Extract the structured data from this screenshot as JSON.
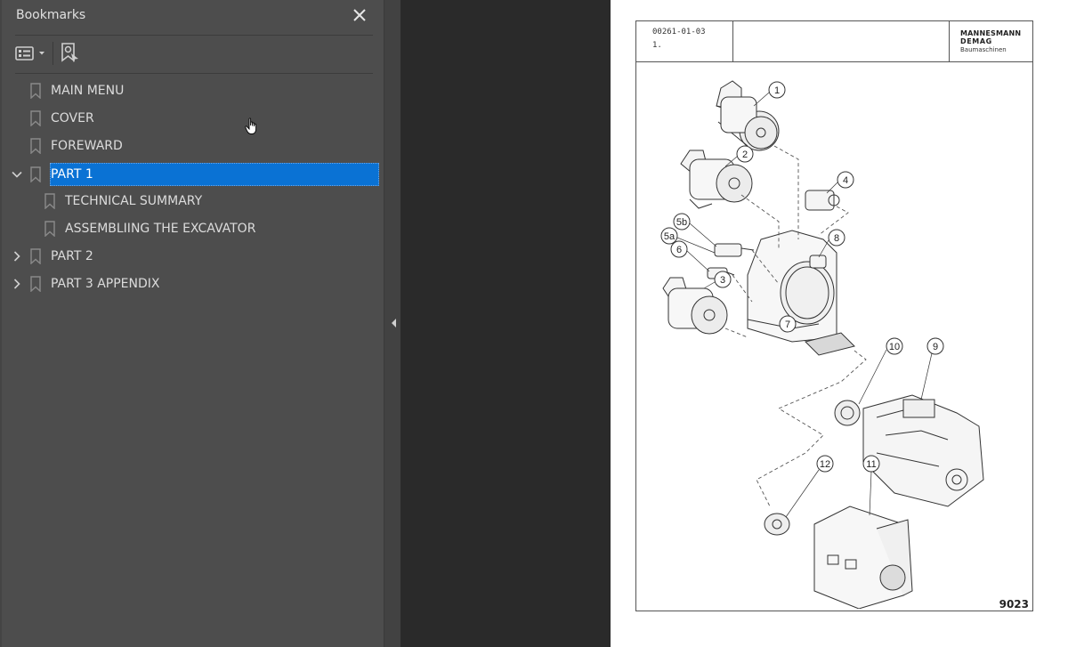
{
  "bookmarks_panel": {
    "title": "Bookmarks",
    "close_icon": "close-icon",
    "toolbar": {
      "options_button": "options-list-icon",
      "find_bookmark_button": "find-current-bookmark-icon"
    },
    "items": [
      {
        "label": "MAIN MENU",
        "level": 0,
        "expander": "none",
        "selected": false
      },
      {
        "label": "COVER",
        "level": 0,
        "expander": "none",
        "selected": false
      },
      {
        "label": "FOREWARD",
        "level": 0,
        "expander": "none",
        "selected": false
      },
      {
        "label": "PART 1",
        "level": 0,
        "expander": "expanded",
        "selected": true
      },
      {
        "label": "TECHNICAL SUMMARY",
        "level": 1,
        "expander": "none",
        "selected": false
      },
      {
        "label": "ASSEMBLIING THE EXCAVATOR",
        "level": 1,
        "expander": "none",
        "selected": false
      },
      {
        "label": "PART 2",
        "level": 0,
        "expander": "collapsed",
        "selected": false
      },
      {
        "label": "PART 3 APPENDIX",
        "level": 0,
        "expander": "collapsed",
        "selected": false
      }
    ],
    "selection_color": "#0a72d4"
  },
  "splitter": {
    "collapse_icon": "collapse-left-arrow-icon"
  },
  "document_page": {
    "doc_code": "00261-01-03",
    "section": "1.",
    "brand_line1": "MANNESMANN",
    "brand_line2": "DEMAG",
    "brand_line3": "Baumaschinen",
    "page_number": "9023",
    "callouts": [
      "1",
      "2",
      "3",
      "4",
      "5b",
      "5a",
      "6",
      "7",
      "8",
      "9",
      "10",
      "11",
      "12"
    ]
  }
}
